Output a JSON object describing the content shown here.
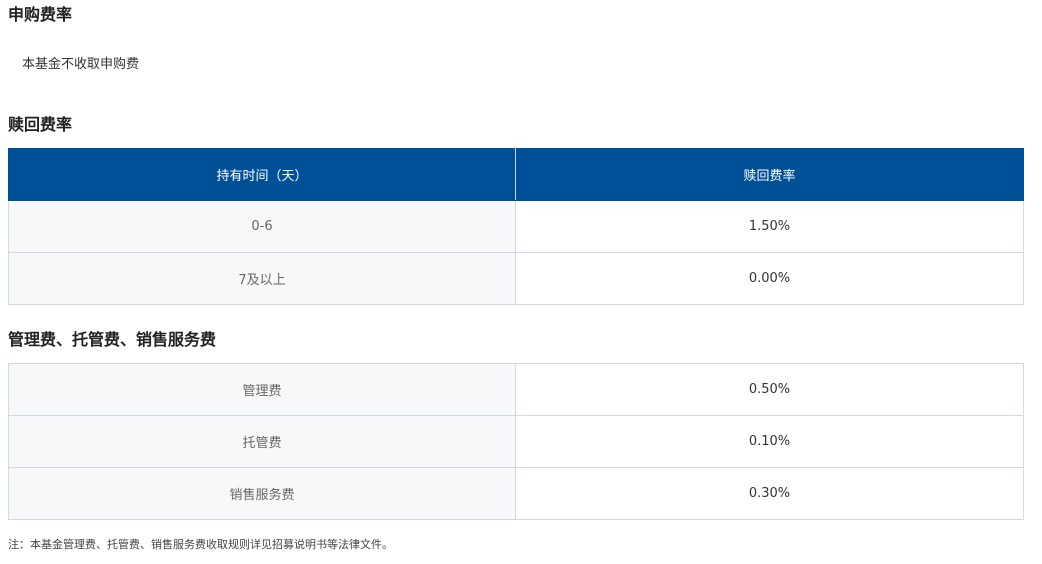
{
  "subscription": {
    "title": "申购费率",
    "text": "本基金不收取申购费"
  },
  "redemption": {
    "title": "赎回费率",
    "headers": [
      "持有时间（天）",
      "赎回费率"
    ],
    "rows": [
      {
        "period": "0-6",
        "rate": "1.50%"
      },
      {
        "period": "7及以上",
        "rate": "0.00%"
      }
    ]
  },
  "management": {
    "title": "管理费、托管费、销售服务费",
    "rows": [
      {
        "name": "管理费",
        "rate": "0.50%"
      },
      {
        "name": "托管费",
        "rate": "0.10%"
      },
      {
        "name": "销售服务费",
        "rate": "0.30%"
      }
    ]
  },
  "note": "注：本基金管理费、托管费、销售服务费收取规则详见招募说明书等法律文件。",
  "colors": {
    "header_bg": "#005098",
    "label_bg": "#f7f8fa",
    "border": "#d3d9e4"
  }
}
